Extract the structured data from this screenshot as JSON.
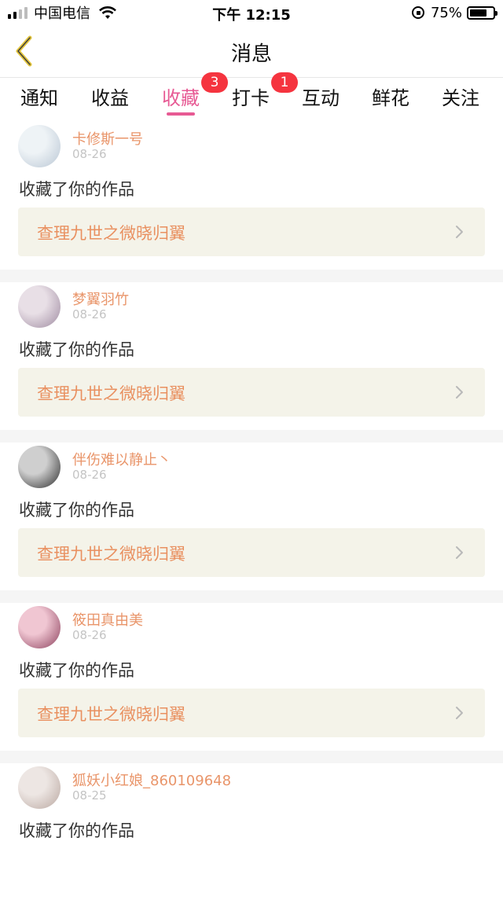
{
  "status_bar": {
    "carrier": "中国电信",
    "time": "下午 12:15",
    "battery_percent": "75%",
    "battery_level": 0.75
  },
  "header": {
    "title": "消息"
  },
  "tabs": [
    {
      "label": "通知"
    },
    {
      "label": "收益"
    },
    {
      "label": "收藏",
      "badge": "3",
      "active": true
    },
    {
      "label": "打卡",
      "badge": "1"
    },
    {
      "label": "互动"
    },
    {
      "label": "鲜花"
    },
    {
      "label": "关注"
    }
  ],
  "feed": [
    {
      "username": "卡修斯一号",
      "date": "08-26",
      "action": "收藏了你的作品",
      "work_title": "查理九世之微晓归翼",
      "avatar_colors": [
        "#eef3f6",
        "#b9c6d4"
      ]
    },
    {
      "username": "梦翼羽竹",
      "date": "08-26",
      "action": "收藏了你的作品",
      "work_title": "查理九世之微晓归翼",
      "avatar_colors": [
        "#e8dfe6",
        "#9e8aa0"
      ]
    },
    {
      "username": "伴伤难以静止丶",
      "date": "08-26",
      "action": "收藏了你的作品",
      "work_title": "查理九世之微晓归翼",
      "avatar_colors": [
        "#cfcfcf",
        "#2b2b2b"
      ]
    },
    {
      "username": "筱田真由美",
      "date": "08-26",
      "action": "收藏了你的作品",
      "work_title": "查理九世之微晓归翼",
      "avatar_colors": [
        "#f0c6d2",
        "#8b3f5c"
      ]
    },
    {
      "username": "狐妖小红娘_860109648",
      "date": "08-25",
      "action": "收藏了你的作品",
      "work_title": "",
      "avatar_colors": [
        "#ede6e3",
        "#b9a7a0"
      ]
    }
  ],
  "colors": {
    "accent": "#e75a94",
    "badge": "#f5343f",
    "username": "#e9956a",
    "work_title": "#e99060",
    "work_bg": "#f4f3e9"
  },
  "icons": {
    "back": "chevron-left-icon",
    "arrow": "chevron-right-icon",
    "wifi": "wifi-icon",
    "battery": "battery-icon"
  }
}
